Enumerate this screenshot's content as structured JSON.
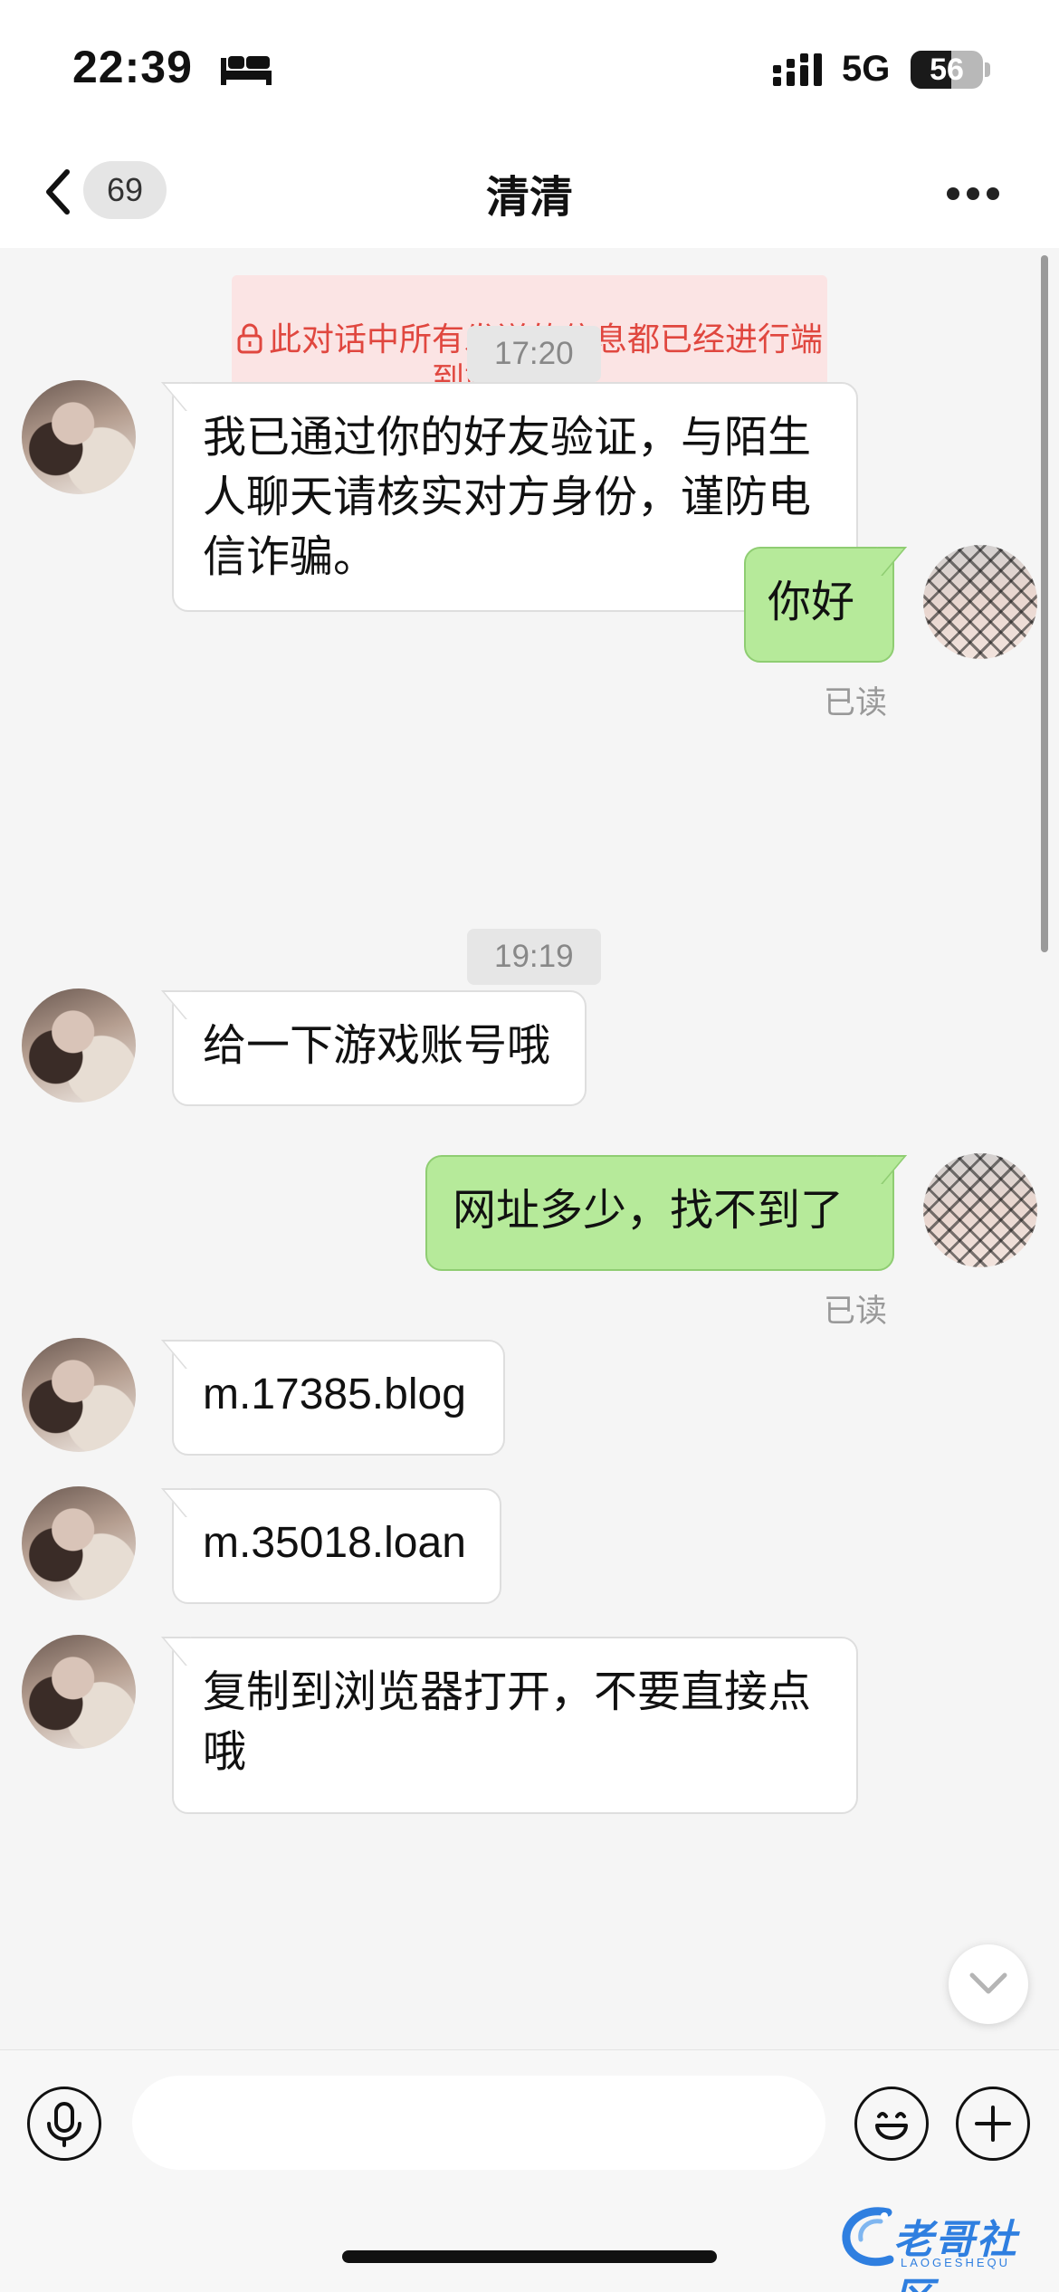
{
  "status_bar": {
    "time": "22:39",
    "network": "5G",
    "battery": "56",
    "battery_level_percent": 56
  },
  "header": {
    "back_badge": "69",
    "title": "清清"
  },
  "notice": {
    "text": "此对话中所有发送的信息都已经进行端到端的加密。"
  },
  "conversation": {
    "time_1": "17:20",
    "msg_1": "我已通过你的好友验证，与陌生人聊天请核实对方身份，谨防电信诈骗。",
    "msg_2": "你好",
    "read_1": "已读",
    "time_2": "19:19",
    "msg_3": "给一下游戏账号哦",
    "msg_4": "网址多少，找不到了",
    "read_2": "已读",
    "msg_5": "m.17385.blog",
    "msg_6": "m.35018.loan",
    "msg_7": "复制到浏览器打开，不要直接点哦"
  },
  "input": {
    "value": ""
  },
  "watermark": {
    "text": "老哥社区",
    "sub": "LAOGESHEQU"
  }
}
